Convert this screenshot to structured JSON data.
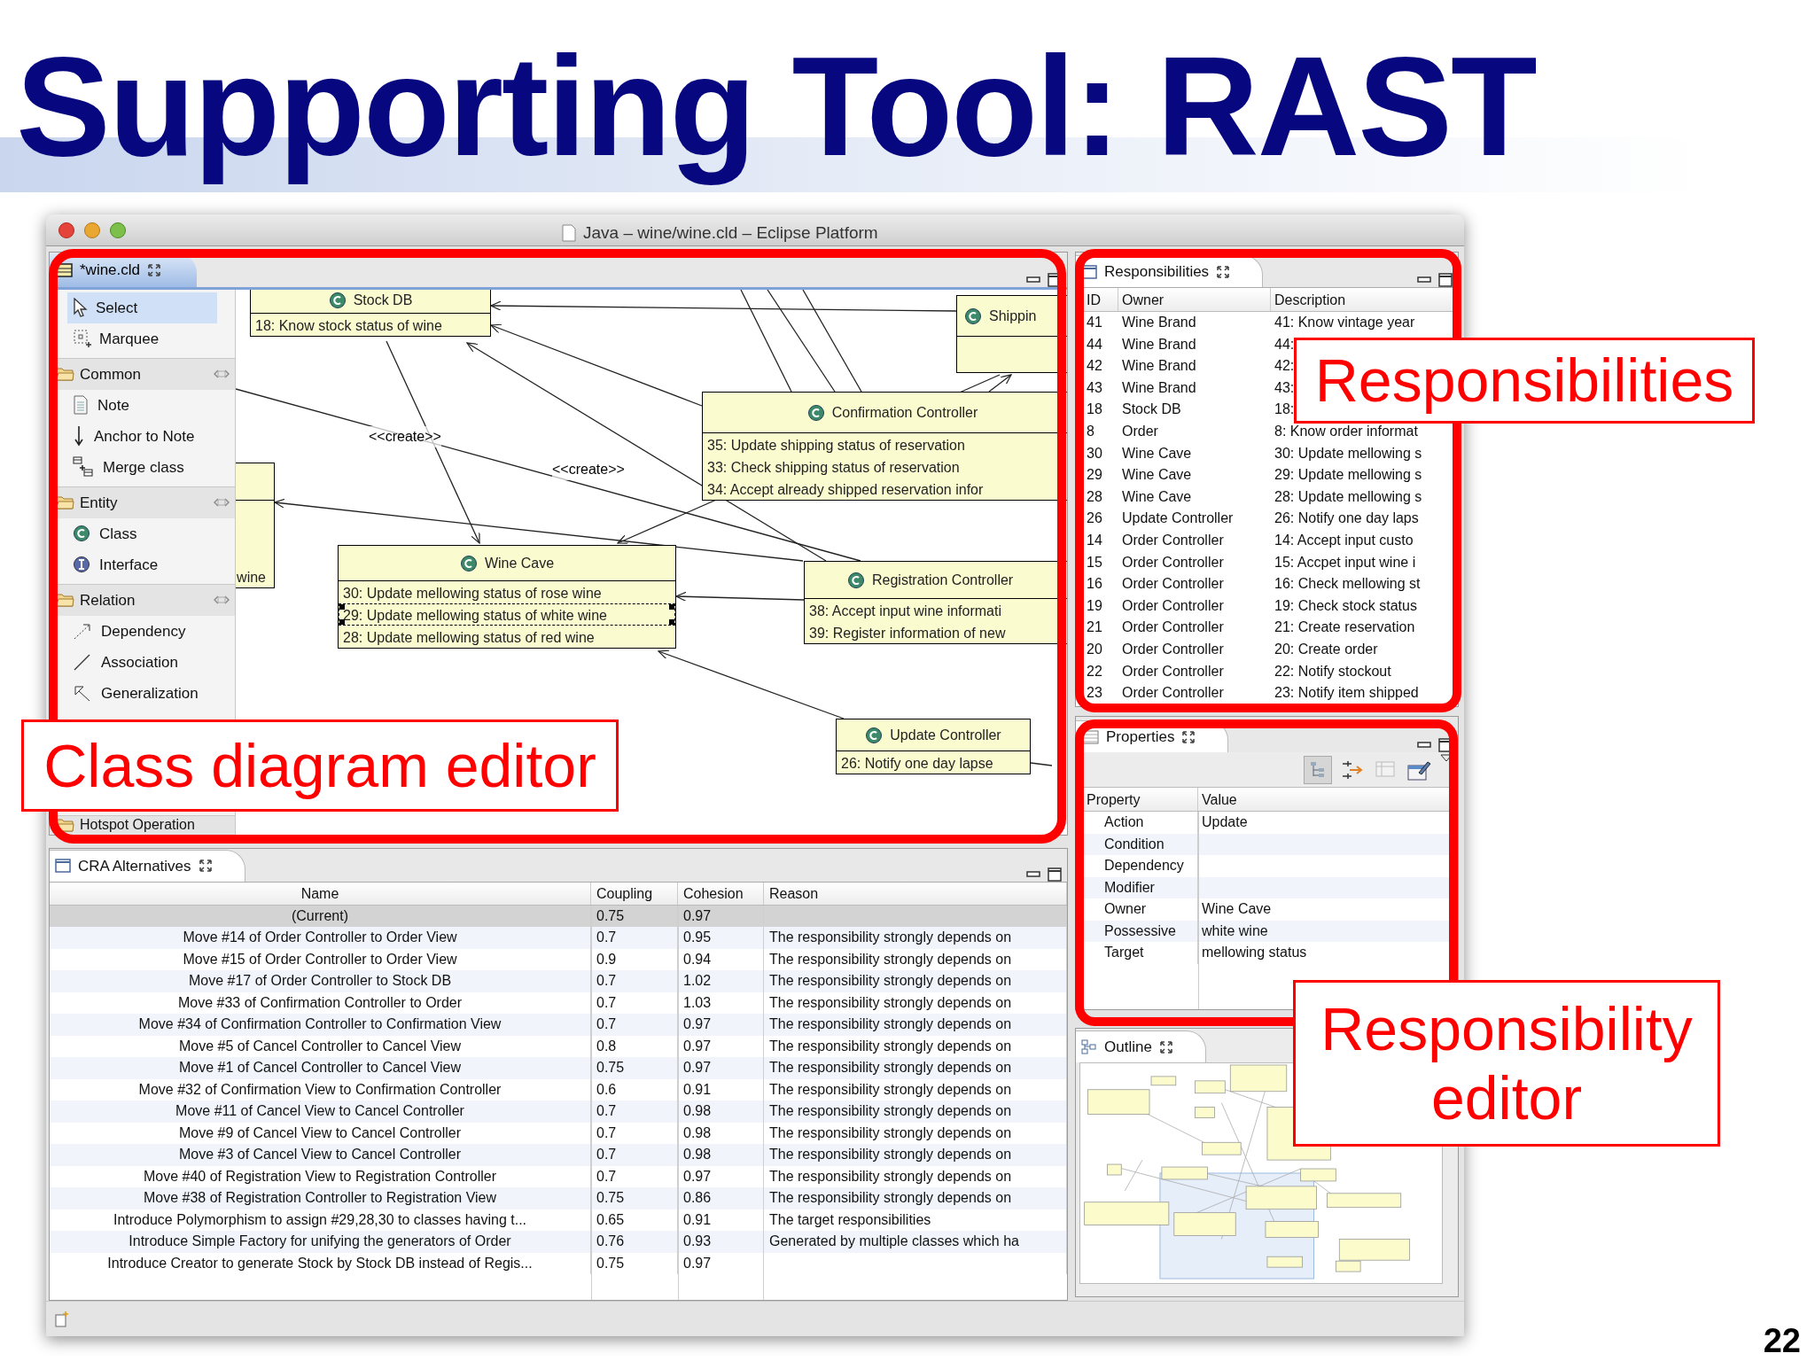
{
  "slide": {
    "title": "Supporting Tool: RAST",
    "page_number": "22"
  },
  "window": {
    "title": "Java – wine/wine.cld – Eclipse Platform"
  },
  "editor": {
    "tab": "*wine.cld",
    "palette": {
      "tools": [
        {
          "label": "Select",
          "kind": "select",
          "selected": true
        },
        {
          "label": "Marquee",
          "kind": "marquee",
          "selected": false
        }
      ],
      "drawers": [
        {
          "label": "Common",
          "items": [
            {
              "label": "Note",
              "kind": "note"
            },
            {
              "label": "Anchor to Note",
              "kind": "anchor"
            },
            {
              "label": "Merge class",
              "kind": "merge"
            }
          ]
        },
        {
          "label": "Entity",
          "items": [
            {
              "label": "Class",
              "kind": "class"
            },
            {
              "label": "Interface",
              "kind": "interface"
            }
          ]
        },
        {
          "label": "Relation",
          "items": [
            {
              "label": "Dependency",
              "kind": "dependency"
            },
            {
              "label": "Association",
              "kind": "association"
            },
            {
              "label": "Generalization",
              "kind": "generalization"
            }
          ]
        },
        {
          "label": "Hotspot Operation"
        }
      ]
    },
    "diagram": {
      "classes": [
        {
          "name": "Stock DB",
          "responsibilities": [
            {
              "text": "18: Know stock status of wine",
              "selected": false
            }
          ]
        },
        {
          "name": "Shippin"
        },
        {
          "responsibilities": [
            {
              "text": "wine",
              "selected": false
            }
          ]
        },
        {
          "name": "Confirmation Controller",
          "responsibilities": [
            {
              "text": "35: Update shipping status of reservation",
              "selected": false
            },
            {
              "text": "33: Check shipping status of reservation",
              "selected": false
            },
            {
              "text": "34: Accept already shipped reservation infor",
              "selected": false
            }
          ]
        },
        {
          "name": "Wine Cave",
          "responsibilities": [
            {
              "text": "30: Update mellowing status of rose wine",
              "selected": false
            },
            {
              "text": "29: Update mellowing status of white wine",
              "selected": true
            },
            {
              "text": "28: Update mellowing status of red wine",
              "selected": false
            }
          ]
        },
        {
          "name": "Registration Controller",
          "responsibilities": [
            {
              "text": "38: Accept input wine informati",
              "selected": false
            },
            {
              "text": "39: Register information of new",
              "selected": false
            }
          ]
        },
        {
          "name": "Update Controller",
          "responsibilities": [
            {
              "text": "26: Notify one day lapse",
              "selected": false
            }
          ]
        }
      ],
      "labels": [
        "<<create>>",
        "<<create>>"
      ]
    }
  },
  "responsibilities": {
    "tab": "Responsibilities",
    "columns": [
      "ID",
      "Owner",
      "Description"
    ],
    "rows": [
      {
        "id": "41",
        "owner": "Wine Brand",
        "description": "41: Know vintage year"
      },
      {
        "id": "44",
        "owner": "Wine Brand",
        "description": "44:"
      },
      {
        "id": "42",
        "owner": "Wine Brand",
        "description": "42:"
      },
      {
        "id": "43",
        "owner": "Wine Brand",
        "description": "43:"
      },
      {
        "id": "18",
        "owner": "Stock DB",
        "description": "18:"
      },
      {
        "id": "8",
        "owner": "Order",
        "description": "8: Know order informat"
      },
      {
        "id": "30",
        "owner": "Wine Cave",
        "description": "30: Update mellowing s"
      },
      {
        "id": "29",
        "owner": "Wine Cave",
        "description": "29: Update mellowing s"
      },
      {
        "id": "28",
        "owner": "Wine Cave",
        "description": "28: Update mellowing s"
      },
      {
        "id": "26",
        "owner": "Update Controller",
        "description": "26: Notify one day laps"
      },
      {
        "id": "14",
        "owner": "Order Controller",
        "description": "14: Accept input custo"
      },
      {
        "id": "15",
        "owner": "Order Controller",
        "description": "15: Accpet input wine i"
      },
      {
        "id": "16",
        "owner": "Order Controller",
        "description": "16: Check mellowing st"
      },
      {
        "id": "19",
        "owner": "Order Controller",
        "description": "19: Check stock status"
      },
      {
        "id": "21",
        "owner": "Order Controller",
        "description": "21: Create reservation"
      },
      {
        "id": "20",
        "owner": "Order Controller",
        "description": "20: Create order"
      },
      {
        "id": "22",
        "owner": "Order Controller",
        "description": "22: Notify stockout"
      },
      {
        "id": "23",
        "owner": "Order Controller",
        "description": "23: Notify item shipped"
      }
    ]
  },
  "properties": {
    "tab": "Properties",
    "columns": [
      "Property",
      "Value"
    ],
    "rows": [
      {
        "property": "Action",
        "value": "Update"
      },
      {
        "property": "Condition"
      },
      {
        "property": "Dependency"
      },
      {
        "property": "Modifier"
      },
      {
        "property": "Owner",
        "value": "Wine Cave"
      },
      {
        "property": "Possessive",
        "value": "white wine"
      },
      {
        "property": "Target",
        "value": "mellowing status"
      }
    ]
  },
  "outline": {
    "tab": "Outline"
  },
  "cra_alternatives": {
    "tab": "CRA Alternatives",
    "columns": [
      "Name",
      "Coupling",
      "Cohesion",
      "Reason"
    ],
    "rows": [
      {
        "name": "(Current)",
        "coupling": "0.75",
        "cohesion": "0.97",
        "selected": true
      },
      {
        "name": "Move #14 of Order Controller to Order View",
        "coupling": "0.7",
        "cohesion": "0.95",
        "reason": "The responsibility strongly depends on",
        "selected": false
      },
      {
        "name": "Move #15 of Order Controller to Order View",
        "coupling": "0.9",
        "cohesion": "0.94",
        "reason": "The responsibility strongly depends on",
        "selected": false
      },
      {
        "name": "Move #17 of Order Controller to Stock DB",
        "coupling": "0.7",
        "cohesion": "1.02",
        "reason": "The responsibility strongly depends on",
        "selected": false
      },
      {
        "name": "Move #33 of Confirmation Controller to Order",
        "coupling": "0.7",
        "cohesion": "1.03",
        "reason": "The responsibility strongly depends on",
        "selected": false
      },
      {
        "name": "Move #34 of Confirmation Controller to Confirmation View",
        "coupling": "0.7",
        "cohesion": "0.97",
        "reason": "The responsibility strongly depends on",
        "selected": false
      },
      {
        "name": "Move #5 of Cancel Controller to Cancel View",
        "coupling": "0.8",
        "cohesion": "0.97",
        "reason": "The responsibility strongly depends on",
        "selected": false
      },
      {
        "name": "Move #1 of Cancel Controller to Cancel View",
        "coupling": "0.75",
        "cohesion": "0.97",
        "reason": "The responsibility strongly depends on",
        "selected": false
      },
      {
        "name": "Move #32 of Confirmation View to Confirmation Controller",
        "coupling": "0.6",
        "cohesion": "0.91",
        "reason": "The responsibility strongly depends on",
        "selected": false
      },
      {
        "name": "Move #11 of Cancel View to Cancel Controller",
        "coupling": "0.7",
        "cohesion": "0.98",
        "reason": "The responsibility strongly depends on",
        "selected": false
      },
      {
        "name": "Move #9 of Cancel View to Cancel Controller",
        "coupling": "0.7",
        "cohesion": "0.98",
        "reason": "The responsibility strongly depends on",
        "selected": false
      },
      {
        "name": "Move #3 of Cancel View to Cancel Controller",
        "coupling": "0.7",
        "cohesion": "0.98",
        "reason": "The responsibility strongly depends on",
        "selected": false
      },
      {
        "name": "Move #40 of Registration View to Registration Controller",
        "coupling": "0.7",
        "cohesion": "0.97",
        "reason": "The responsibility strongly depends on",
        "selected": false
      },
      {
        "name": "Move #38 of Registration Controller to Registration View",
        "coupling": "0.75",
        "cohesion": "0.86",
        "reason": "The responsibility strongly depends on",
        "selected": false
      },
      {
        "name": "Introduce Polymorphism to assign #29,28,30 to classes having t...",
        "coupling": "0.65",
        "cohesion": "0.91",
        "reason": "The target responsibilities",
        "selected": false
      },
      {
        "name": "Introduce Simple Factory for unifying the generators of Order",
        "coupling": "0.76",
        "cohesion": "0.93",
        "reason": "Generated by multiple classes which ha",
        "selected": false
      },
      {
        "name": "Introduce Creator to generate Stock by Stock DB instead of Regis...",
        "coupling": "0.75",
        "cohesion": "0.97",
        "selected": false
      }
    ]
  },
  "annotations": [
    {
      "text": "Class diagram editor"
    },
    {
      "text": "Responsibilities"
    },
    {
      "text": "Responsibility editor"
    }
  ]
}
